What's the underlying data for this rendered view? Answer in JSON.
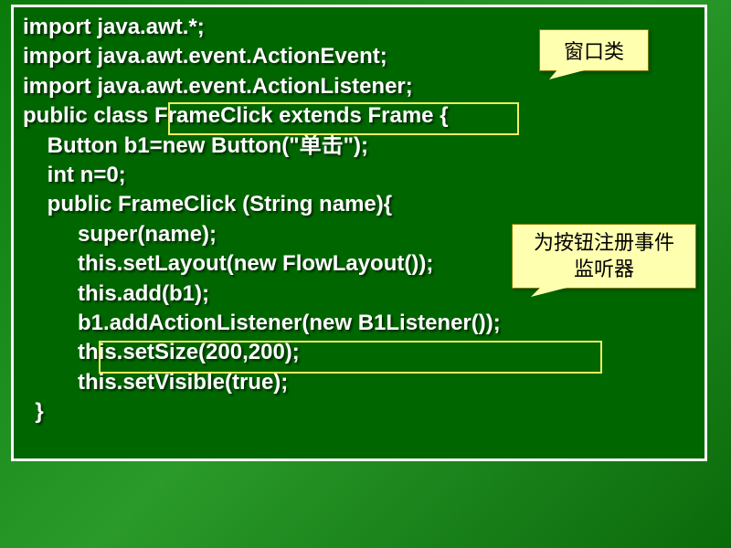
{
  "code": {
    "line1": "import java.awt.*;",
    "line2": "import java.awt.event.ActionEvent;",
    "line3": "import java.awt.event.ActionListener;",
    "line4": "public class FrameClick extends Frame {",
    "line5": "    Button b1=new Button(\"单击\");",
    "line6": "    int n=0;",
    "line7": "    public FrameClick (String name){",
    "line8": "         super(name);",
    "line9": "         this.setLayout(new FlowLayout());",
    "line10": "         this.add(b1);",
    "line11": "         b1.addActionListener(new B1Listener());",
    "line12": "         this.setSize(200,200);",
    "line13": "         this.setVisible(true);",
    "line14": "  }"
  },
  "callouts": {
    "c1": "窗口类",
    "c2": "为按钮注册事件监听器"
  }
}
